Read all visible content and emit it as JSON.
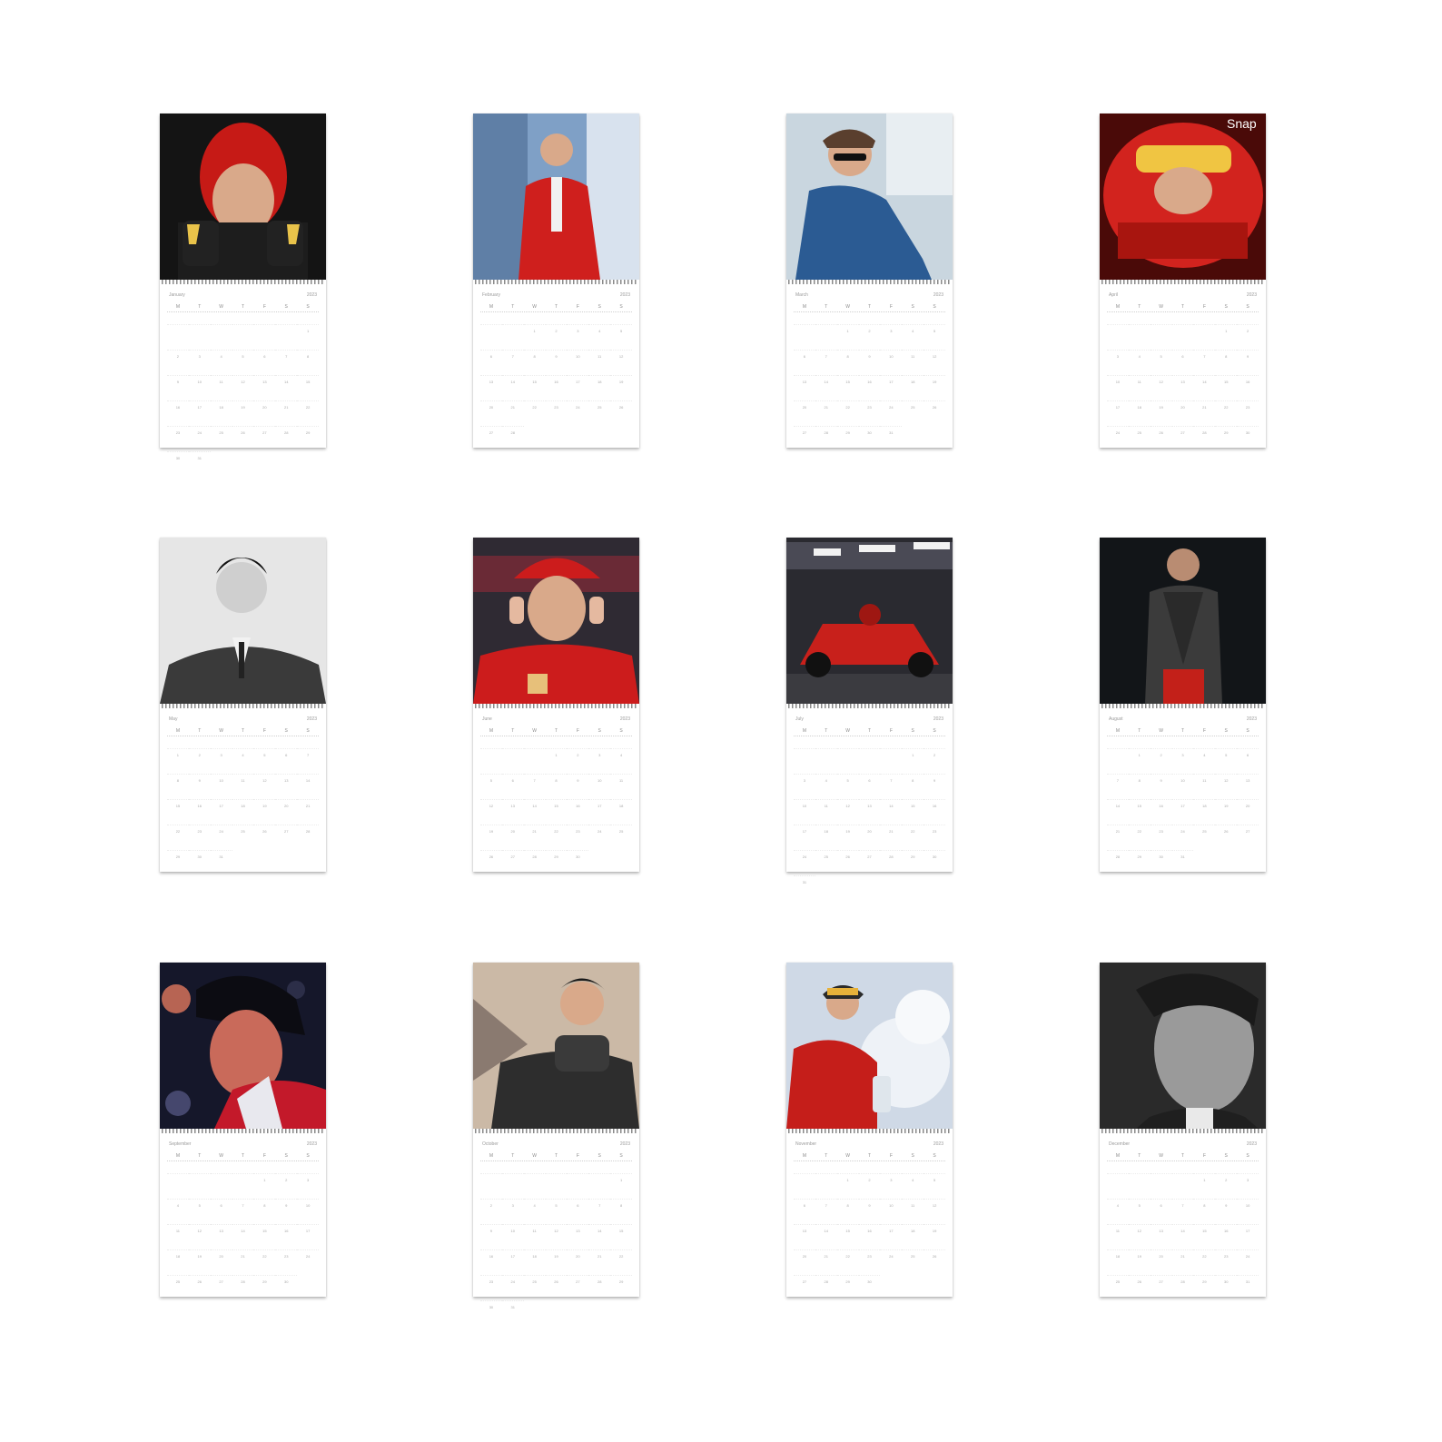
{
  "calendar": {
    "year": "2023",
    "weekdays": [
      "M",
      "T",
      "W",
      "T",
      "F",
      "S",
      "S"
    ],
    "months": [
      {
        "name": "January",
        "first_weekday": 6,
        "days": 31,
        "photo": "helmet-balaclava-portrait",
        "palette": [
          "#141414",
          "#c61a16",
          "#e9c34a"
        ]
      },
      {
        "name": "February",
        "first_weekday": 2,
        "days": 28,
        "photo": "red-team-jacket-city",
        "palette": [
          "#7fa0c6",
          "#cf1f1d",
          "#f1f1f1"
        ]
      },
      {
        "name": "March",
        "first_weekday": 2,
        "days": 31,
        "photo": "sunglasses-denim-shirt",
        "palette": [
          "#c9d6df",
          "#2b5b93",
          "#5a3f2e"
        ]
      },
      {
        "name": "April",
        "first_weekday": 5,
        "days": 30,
        "photo": "racing-helmet-closeup",
        "palette": [
          "#4a0a08",
          "#d2231e",
          "#f0e3c8"
        ]
      },
      {
        "name": "May",
        "first_weekday": 0,
        "days": 31,
        "photo": "black-and-white-suit",
        "palette": [
          "#e6e6e6",
          "#3a3a3a",
          "#111111"
        ]
      },
      {
        "name": "June",
        "first_weekday": 3,
        "days": 30,
        "photo": "red-cap-headphones",
        "palette": [
          "#2f2a33",
          "#cc1c1c",
          "#e7c07a"
        ]
      },
      {
        "name": "July",
        "first_weekday": 5,
        "days": 31,
        "photo": "red-race-car-night",
        "palette": [
          "#2a2a30",
          "#c8201b",
          "#f2f2f2"
        ]
      },
      {
        "name": "August",
        "first_weekday": 1,
        "days": 31,
        "photo": "leather-jacket-dark",
        "palette": [
          "#121518",
          "#3b3b3b",
          "#c32019"
        ]
      },
      {
        "name": "September",
        "first_weekday": 4,
        "days": 30,
        "photo": "bokeh-night-portrait",
        "palette": [
          "#15172a",
          "#c96a5a",
          "#c3192a"
        ]
      },
      {
        "name": "October",
        "first_weekday": 6,
        "days": 31,
        "photo": "dark-sweater-seaside",
        "palette": [
          "#cbb9a6",
          "#2d2d2d",
          "#6e5a4a"
        ]
      },
      {
        "name": "November",
        "first_weekday": 2,
        "days": 30,
        "photo": "champagne-celebration",
        "palette": [
          "#cfd9e6",
          "#c51e1a",
          "#f4f4f4"
        ]
      },
      {
        "name": "December",
        "first_weekday": 4,
        "days": 31,
        "photo": "black-and-white-headshot",
        "palette": [
          "#2a2a2a",
          "#9a9a9a",
          "#e9e9e9"
        ]
      }
    ]
  }
}
